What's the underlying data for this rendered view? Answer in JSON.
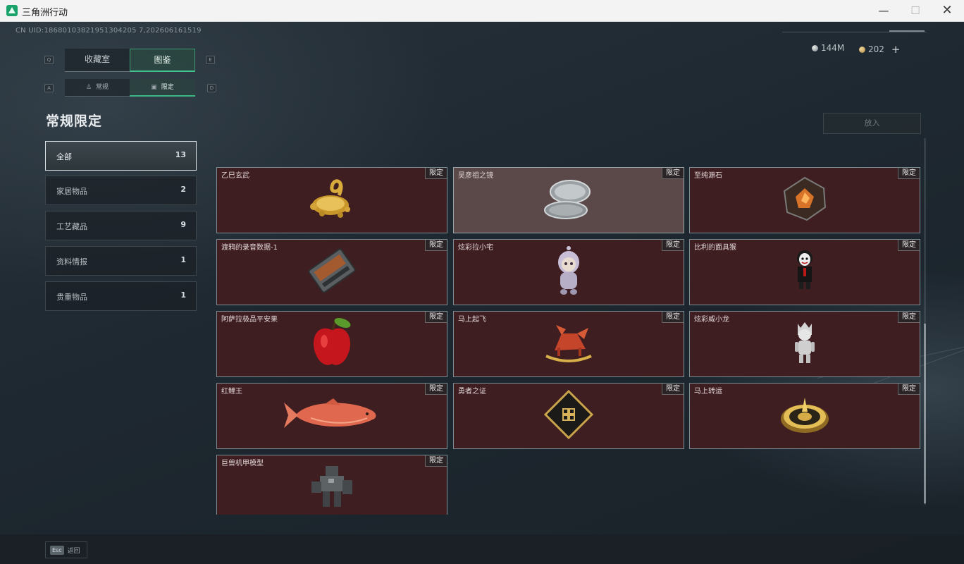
{
  "window": {
    "title": "三角洲行动",
    "min": "—",
    "max": "☐",
    "close": "✕"
  },
  "uid": "CN UID:18680103821951304205 7,202606161519",
  "currency": {
    "silver": "144M",
    "gold": "202",
    "plus": "+"
  },
  "tabs": {
    "left_key": "Q",
    "right_key": "E",
    "collection": "收藏室",
    "gallery": "图鉴"
  },
  "subtabs": {
    "left_key": "A",
    "right_key": "D",
    "normal": "常规",
    "limited": "限定"
  },
  "page_title": "常规限定",
  "place_button": "放入",
  "categories": [
    {
      "label": "全部",
      "count": "13"
    },
    {
      "label": "家居物品",
      "count": "2"
    },
    {
      "label": "工艺藏品",
      "count": "9"
    },
    {
      "label": "资料情报",
      "count": "1"
    },
    {
      "label": "贵重物品",
      "count": "1"
    }
  ],
  "items": [
    {
      "name": "乙巳玄武",
      "badge": "限定",
      "icon": "golden-turtle-snake-icon"
    },
    {
      "name": "吴彦祖之镜",
      "badge": "限定",
      "icon": "compact-mirror-icon"
    },
    {
      "name": "至纯源石",
      "badge": "限定",
      "icon": "source-stone-icon"
    },
    {
      "name": "渡鸦的录音数据-1",
      "badge": "限定",
      "icon": "recorder-device-icon"
    },
    {
      "name": "炫彩拉小宅",
      "badge": "限定",
      "icon": "doll-figure-icon"
    },
    {
      "name": "比利的面具猴",
      "badge": "限定",
      "icon": "puppet-figure-icon"
    },
    {
      "name": "阿萨拉极品平安果",
      "badge": "限定",
      "icon": "red-apple-icon"
    },
    {
      "name": "马上起飞",
      "badge": "限定",
      "icon": "rocking-horse-icon"
    },
    {
      "name": "炫彩威小龙",
      "badge": "限定",
      "icon": "white-figure-icon"
    },
    {
      "name": "红鲤王",
      "badge": "限定",
      "icon": "red-carp-icon"
    },
    {
      "name": "勇者之证",
      "badge": "限定",
      "icon": "brave-card-icon"
    },
    {
      "name": "马上转运",
      "badge": "限定",
      "icon": "golden-dial-icon"
    },
    {
      "name": "巨兽机甲模型",
      "badge": "限定",
      "icon": "mech-model-icon"
    }
  ],
  "footer": {
    "esc_key": "Esc",
    "esc_label": "返回"
  }
}
